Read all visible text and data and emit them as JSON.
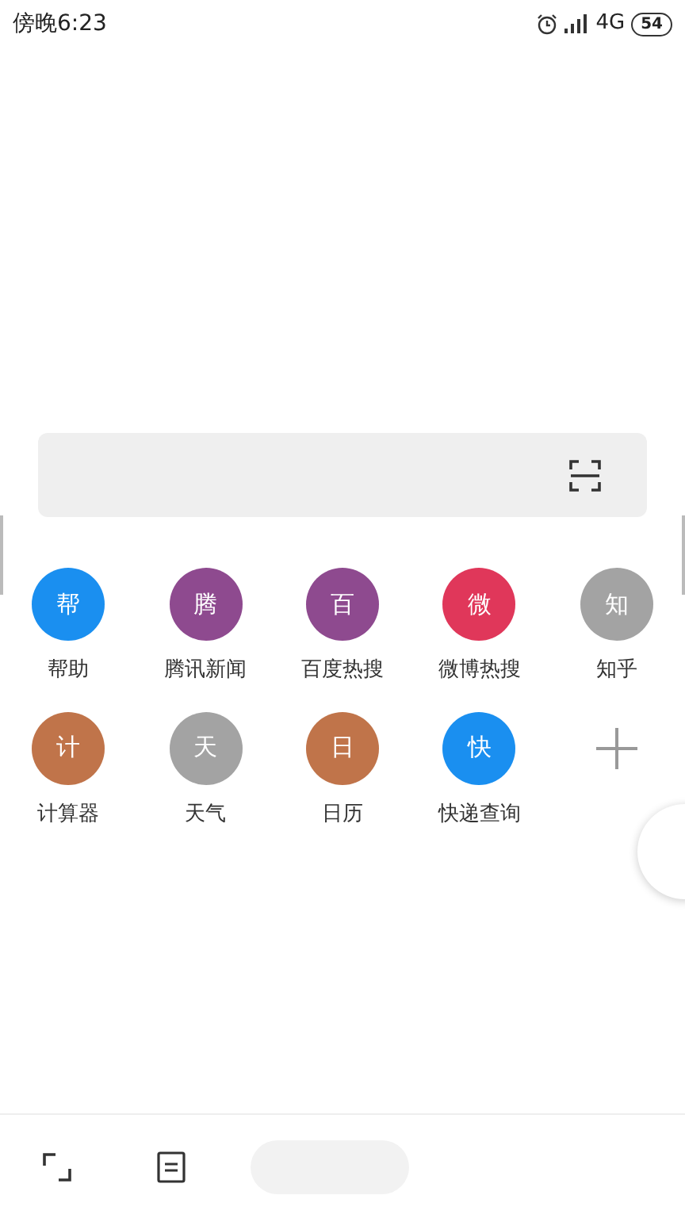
{
  "status_bar": {
    "time": "傍晚6:23",
    "network": "4G",
    "battery": "54"
  },
  "shortcuts": [
    {
      "kind": "site",
      "glyph": "帮",
      "label": "帮助",
      "color": "#1a8ff0"
    },
    {
      "kind": "site",
      "glyph": "腾",
      "label": "腾讯新闻",
      "color": "#8e4a8f"
    },
    {
      "kind": "site",
      "glyph": "百",
      "label": "百度热搜",
      "color": "#8e4a8f"
    },
    {
      "kind": "site",
      "glyph": "微",
      "label": "微博热搜",
      "color": "#e0375a"
    },
    {
      "kind": "site",
      "glyph": "知",
      "label": "知乎",
      "color": "#a3a3a3"
    },
    {
      "kind": "site",
      "glyph": "计",
      "label": "计算器",
      "color": "#c0744a"
    },
    {
      "kind": "site",
      "glyph": "天",
      "label": "天气",
      "color": "#a3a3a3"
    },
    {
      "kind": "site",
      "glyph": "日",
      "label": "日历",
      "color": "#c0744a"
    },
    {
      "kind": "site",
      "glyph": "快",
      "label": "快递查询",
      "color": "#1a8ff0"
    },
    {
      "kind": "add"
    }
  ]
}
